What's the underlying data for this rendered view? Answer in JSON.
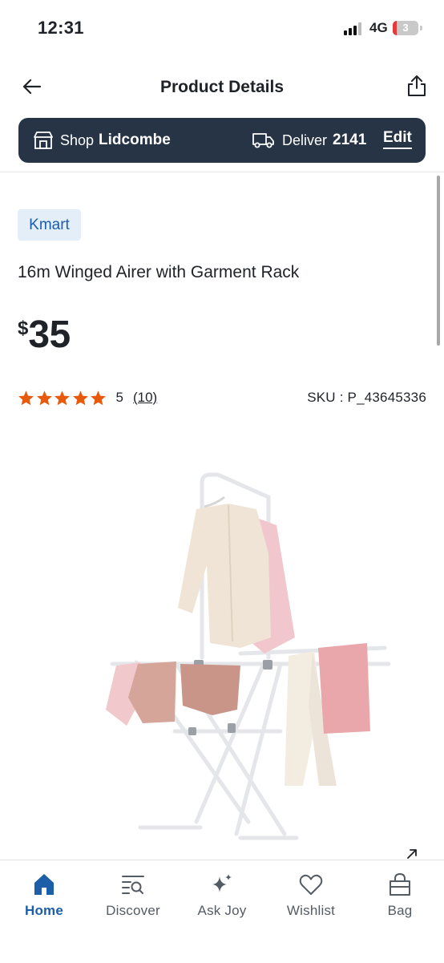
{
  "status_bar": {
    "time": "12:31",
    "network": "4G",
    "battery": "3"
  },
  "header": {
    "title": "Product Details"
  },
  "store_bar": {
    "shop_label": "Shop",
    "shop_value": "Lidcombe",
    "deliver_label": "Deliver",
    "deliver_value": "2141",
    "edit_label": "Edit",
    "background": "#263445"
  },
  "product": {
    "brand": "Kmart",
    "name": "16m Winged Airer with Garment Rack",
    "currency": "$",
    "price": "35",
    "rating": "5",
    "rating_stars": 5,
    "review_count": "(10)",
    "sku": "SKU : P_43645336",
    "star_color": "#e8590c"
  },
  "bottom_nav": {
    "active_color": "#1d5ea8",
    "items": [
      {
        "label": "Home",
        "icon": "home-icon",
        "active": true
      },
      {
        "label": "Discover",
        "icon": "discover-icon",
        "active": false
      },
      {
        "label": "Ask Joy",
        "icon": "sparkle-icon",
        "active": false
      },
      {
        "label": "Wishlist",
        "icon": "heart-icon",
        "active": false
      },
      {
        "label": "Bag",
        "icon": "bag-icon",
        "active": false
      }
    ]
  }
}
